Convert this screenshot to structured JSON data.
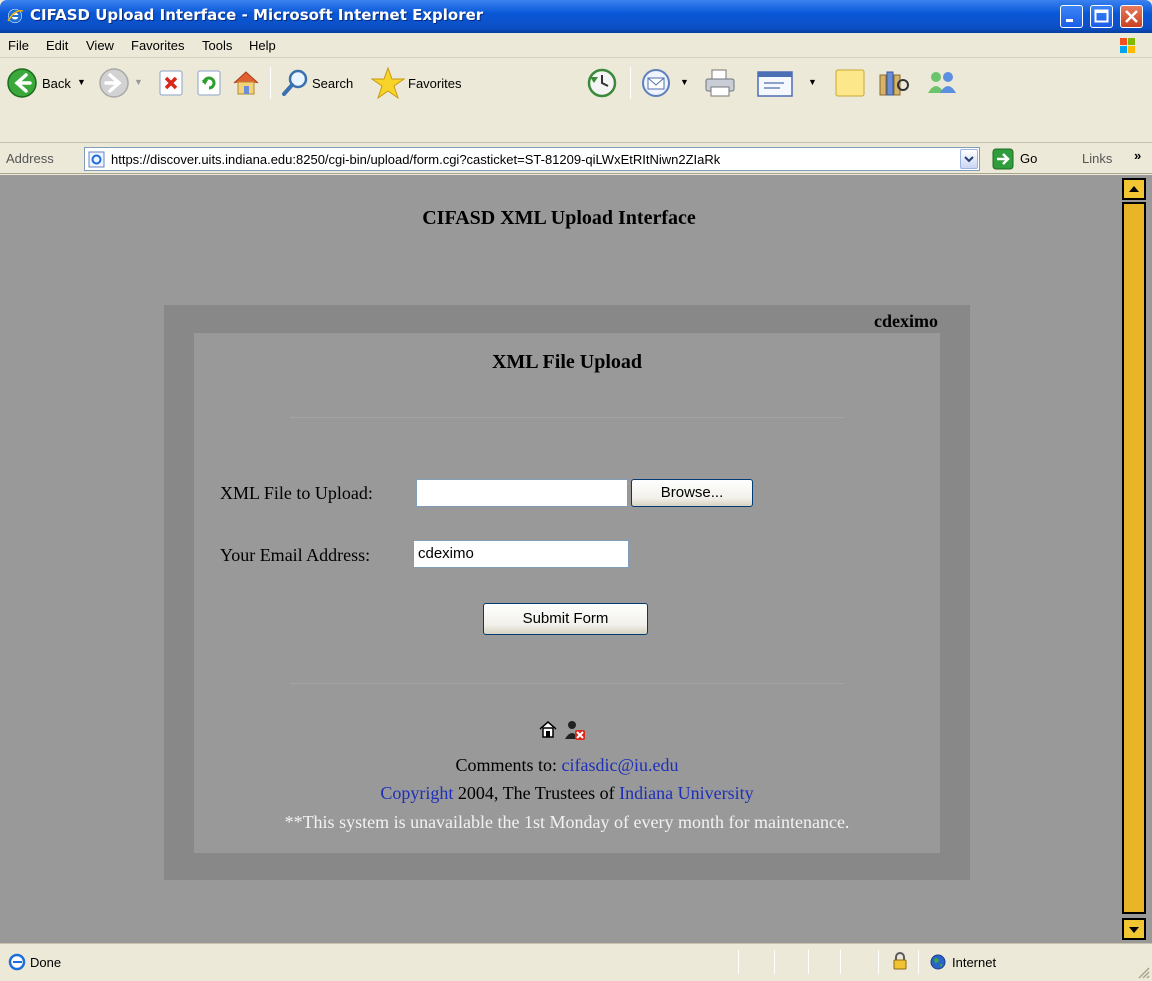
{
  "window": {
    "title": "CIFASD Upload Interface - Microsoft Internet Explorer"
  },
  "menu": {
    "items": [
      "File",
      "Edit",
      "View",
      "Favorites",
      "Tools",
      "Help"
    ]
  },
  "toolbar": {
    "back_label": "Back",
    "search_label": "Search",
    "favorites_label": "Favorites"
  },
  "address_bar": {
    "label": "Address",
    "url": "https://discover.uits.indiana.edu:8250/cgi-bin/upload/form.cgi?casticket=ST-81209-qiLWxEtRItNiwn2ZIaRk",
    "go_label": "Go",
    "links_label": "Links"
  },
  "page": {
    "title": "CIFASD XML Upload Interface",
    "user": "cdeximo",
    "panel_title": "XML File Upload",
    "file_label": "XML File to Upload:",
    "file_value": "",
    "browse_label": "Browse...",
    "email_label": "Your Email Address:",
    "email_value": "cdeximo",
    "submit_label": "Submit Form",
    "footer": {
      "comments_prefix": "Comments to: ",
      "comments_email": "cifasdic@iu.edu",
      "copyright_link": "Copyright",
      "copyright_text": " 2004, The Trustees of ",
      "university_link": "Indiana University",
      "notice": "**This system is unavailable the 1st Monday of every month for maintenance."
    }
  },
  "status_bar": {
    "status": "Done",
    "zone": "Internet"
  },
  "icons": {
    "app": "ie-icon",
    "home": "home-icon",
    "logout": "logout-icon",
    "lock": "lock-icon",
    "zone": "globe-icon"
  },
  "colors": {
    "page_background": "#999999",
    "panel_background": "#888888",
    "link": "#1d2fb8",
    "scrollbar": "#e8b526"
  }
}
